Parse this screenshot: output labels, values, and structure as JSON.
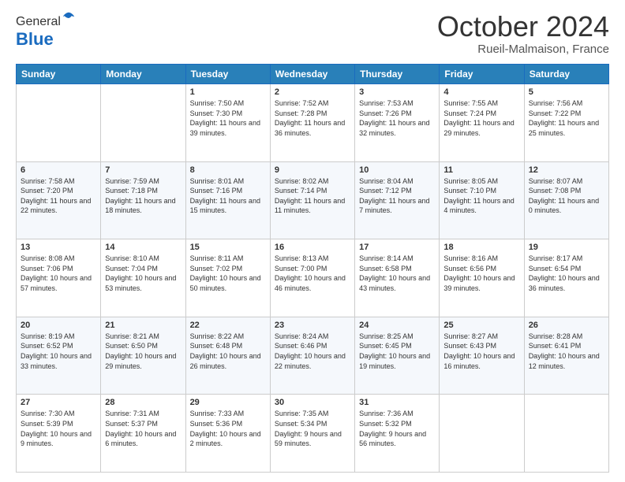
{
  "header": {
    "logo_general": "General",
    "logo_blue": "Blue",
    "title": "October 2024",
    "location": "Rueil-Malmaison, France"
  },
  "days_of_week": [
    "Sunday",
    "Monday",
    "Tuesday",
    "Wednesday",
    "Thursday",
    "Friday",
    "Saturday"
  ],
  "weeks": [
    [
      {
        "day": "",
        "info": ""
      },
      {
        "day": "",
        "info": ""
      },
      {
        "day": "1",
        "info": "Sunrise: 7:50 AM\nSunset: 7:30 PM\nDaylight: 11 hours and 39 minutes."
      },
      {
        "day": "2",
        "info": "Sunrise: 7:52 AM\nSunset: 7:28 PM\nDaylight: 11 hours and 36 minutes."
      },
      {
        "day": "3",
        "info": "Sunrise: 7:53 AM\nSunset: 7:26 PM\nDaylight: 11 hours and 32 minutes."
      },
      {
        "day": "4",
        "info": "Sunrise: 7:55 AM\nSunset: 7:24 PM\nDaylight: 11 hours and 29 minutes."
      },
      {
        "day": "5",
        "info": "Sunrise: 7:56 AM\nSunset: 7:22 PM\nDaylight: 11 hours and 25 minutes."
      }
    ],
    [
      {
        "day": "6",
        "info": "Sunrise: 7:58 AM\nSunset: 7:20 PM\nDaylight: 11 hours and 22 minutes."
      },
      {
        "day": "7",
        "info": "Sunrise: 7:59 AM\nSunset: 7:18 PM\nDaylight: 11 hours and 18 minutes."
      },
      {
        "day": "8",
        "info": "Sunrise: 8:01 AM\nSunset: 7:16 PM\nDaylight: 11 hours and 15 minutes."
      },
      {
        "day": "9",
        "info": "Sunrise: 8:02 AM\nSunset: 7:14 PM\nDaylight: 11 hours and 11 minutes."
      },
      {
        "day": "10",
        "info": "Sunrise: 8:04 AM\nSunset: 7:12 PM\nDaylight: 11 hours and 7 minutes."
      },
      {
        "day": "11",
        "info": "Sunrise: 8:05 AM\nSunset: 7:10 PM\nDaylight: 11 hours and 4 minutes."
      },
      {
        "day": "12",
        "info": "Sunrise: 8:07 AM\nSunset: 7:08 PM\nDaylight: 11 hours and 0 minutes."
      }
    ],
    [
      {
        "day": "13",
        "info": "Sunrise: 8:08 AM\nSunset: 7:06 PM\nDaylight: 10 hours and 57 minutes."
      },
      {
        "day": "14",
        "info": "Sunrise: 8:10 AM\nSunset: 7:04 PM\nDaylight: 10 hours and 53 minutes."
      },
      {
        "day": "15",
        "info": "Sunrise: 8:11 AM\nSunset: 7:02 PM\nDaylight: 10 hours and 50 minutes."
      },
      {
        "day": "16",
        "info": "Sunrise: 8:13 AM\nSunset: 7:00 PM\nDaylight: 10 hours and 46 minutes."
      },
      {
        "day": "17",
        "info": "Sunrise: 8:14 AM\nSunset: 6:58 PM\nDaylight: 10 hours and 43 minutes."
      },
      {
        "day": "18",
        "info": "Sunrise: 8:16 AM\nSunset: 6:56 PM\nDaylight: 10 hours and 39 minutes."
      },
      {
        "day": "19",
        "info": "Sunrise: 8:17 AM\nSunset: 6:54 PM\nDaylight: 10 hours and 36 minutes."
      }
    ],
    [
      {
        "day": "20",
        "info": "Sunrise: 8:19 AM\nSunset: 6:52 PM\nDaylight: 10 hours and 33 minutes."
      },
      {
        "day": "21",
        "info": "Sunrise: 8:21 AM\nSunset: 6:50 PM\nDaylight: 10 hours and 29 minutes."
      },
      {
        "day": "22",
        "info": "Sunrise: 8:22 AM\nSunset: 6:48 PM\nDaylight: 10 hours and 26 minutes."
      },
      {
        "day": "23",
        "info": "Sunrise: 8:24 AM\nSunset: 6:46 PM\nDaylight: 10 hours and 22 minutes."
      },
      {
        "day": "24",
        "info": "Sunrise: 8:25 AM\nSunset: 6:45 PM\nDaylight: 10 hours and 19 minutes."
      },
      {
        "day": "25",
        "info": "Sunrise: 8:27 AM\nSunset: 6:43 PM\nDaylight: 10 hours and 16 minutes."
      },
      {
        "day": "26",
        "info": "Sunrise: 8:28 AM\nSunset: 6:41 PM\nDaylight: 10 hours and 12 minutes."
      }
    ],
    [
      {
        "day": "27",
        "info": "Sunrise: 7:30 AM\nSunset: 5:39 PM\nDaylight: 10 hours and 9 minutes."
      },
      {
        "day": "28",
        "info": "Sunrise: 7:31 AM\nSunset: 5:37 PM\nDaylight: 10 hours and 6 minutes."
      },
      {
        "day": "29",
        "info": "Sunrise: 7:33 AM\nSunset: 5:36 PM\nDaylight: 10 hours and 2 minutes."
      },
      {
        "day": "30",
        "info": "Sunrise: 7:35 AM\nSunset: 5:34 PM\nDaylight: 9 hours and 59 minutes."
      },
      {
        "day": "31",
        "info": "Sunrise: 7:36 AM\nSunset: 5:32 PM\nDaylight: 9 hours and 56 minutes."
      },
      {
        "day": "",
        "info": ""
      },
      {
        "day": "",
        "info": ""
      }
    ]
  ]
}
